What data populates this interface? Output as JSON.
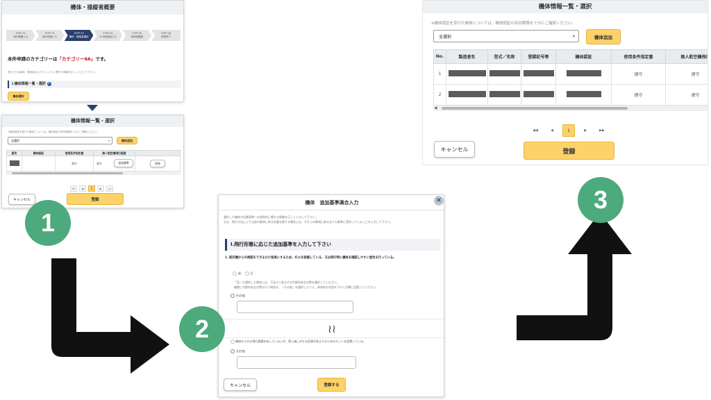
{
  "colors": {
    "accent_yellow": "#fcd269",
    "highlight_red": "#c0161e",
    "step_green": "#4daa7c",
    "nav_blue": "#2a3f6b"
  },
  "panel1": {
    "title": "機体・操縦者概要",
    "steps": [
      {
        "num": "STEP 01",
        "label": "飛行概要入力"
      },
      {
        "num": "STEP 02",
        "label": "飛行詳細入力"
      },
      {
        "num": "STEP 03",
        "label": "機体・操縦者選択"
      },
      {
        "num": "STEP 04",
        "label": "その他詳細入力"
      },
      {
        "num": "STEP 05",
        "label": "申請書確認"
      },
      {
        "num": "STEP 06",
        "label": "申請完了"
      }
    ],
    "category_prefix": "本件申請のカテゴリーは",
    "category_value": "「カテゴリーⅡA」",
    "category_suffix": "です。",
    "note": "飛行させる機体、操縦者およびマニュアルに関する情報を正しく入力して下さい。",
    "section_label": "Ⅰ.機体情報一覧・選択",
    "select_button": "機体選択"
  },
  "panel2": {
    "title": "機体情報一覧・選択",
    "notice": "※機体認証を受けた機体については、機体認証の有効期限を十分にご確認ください。",
    "select_value": "全選択",
    "add_button": "機体追加",
    "columns": [
      "番号",
      "機体認証",
      "使用条件指定書",
      "無人航空機飛行経歴",
      ""
    ],
    "row": {
      "status": "適守",
      "status2": "適守",
      "action": "追加基準",
      "delete": "削除"
    },
    "pages": [
      "⏮",
      "◀",
      "1",
      "▶",
      "⏭"
    ],
    "cancel": "キャンセル",
    "submit": "登録"
  },
  "panel3": {
    "title": "機体　追加基準適合入力",
    "close_icon": "×",
    "intro1": "選択した機体が出庫基準への適合性に関する情報を正しく入力して下さい。",
    "intro2": "なお、飛行方法により当該の事項に係る記載を要する場合には、それらの事項に係る全ての基準に適合していることを入力して下さい。",
    "section": "Ⅰ.飛行形態に応じた追加基準を入力して下さい",
    "question": "1. 航空機からの視認をできるだけ容易にするため、灯火を装備している、又は飛行時に機体を確認しやすい塗色を行っている。",
    "opt_yes": "適",
    "opt_no": "否",
    "hint1": "「否」を選択した場合には、下記より該当する代替的安全対策を選択してください。",
    "hint2": "複数に代替的安全対策を行う場合は、「その他」を選択したうえ、具体的な内容を下の入力欄に記載してください。",
    "other": "その他",
    "omit_icon": "≀≀",
    "bottom_opt": "機体の十分な飛行実績を有していないが、第三者に対する危害を防止するためのネットを設置している。",
    "other2": "その他",
    "cancel": "キャンセル",
    "submit": "登録する"
  },
  "panel4": {
    "title": "機体情報一覧・選択",
    "notice": "※機体認証を受けた機体については、機体認証の有効期限を十分にご確認ください。",
    "select_value": "全選択",
    "add_button": "機体追加",
    "columns": [
      "No.",
      "製造者名",
      "型式／名称",
      "登録記号等",
      "機体認証",
      "使用条件指定書",
      "無人航空機飛行"
    ],
    "rows": [
      {
        "no": "1",
        "status": "適守",
        "status2": "適守"
      },
      {
        "no": "2",
        "status": "適守",
        "status2": "適守"
      }
    ],
    "pages": [
      "◀◀",
      "◀",
      "1",
      "▶",
      "▶▶"
    ],
    "cancel": "キャンセル",
    "submit": "登録"
  },
  "steps": {
    "one": "1",
    "two": "2",
    "three": "3"
  }
}
